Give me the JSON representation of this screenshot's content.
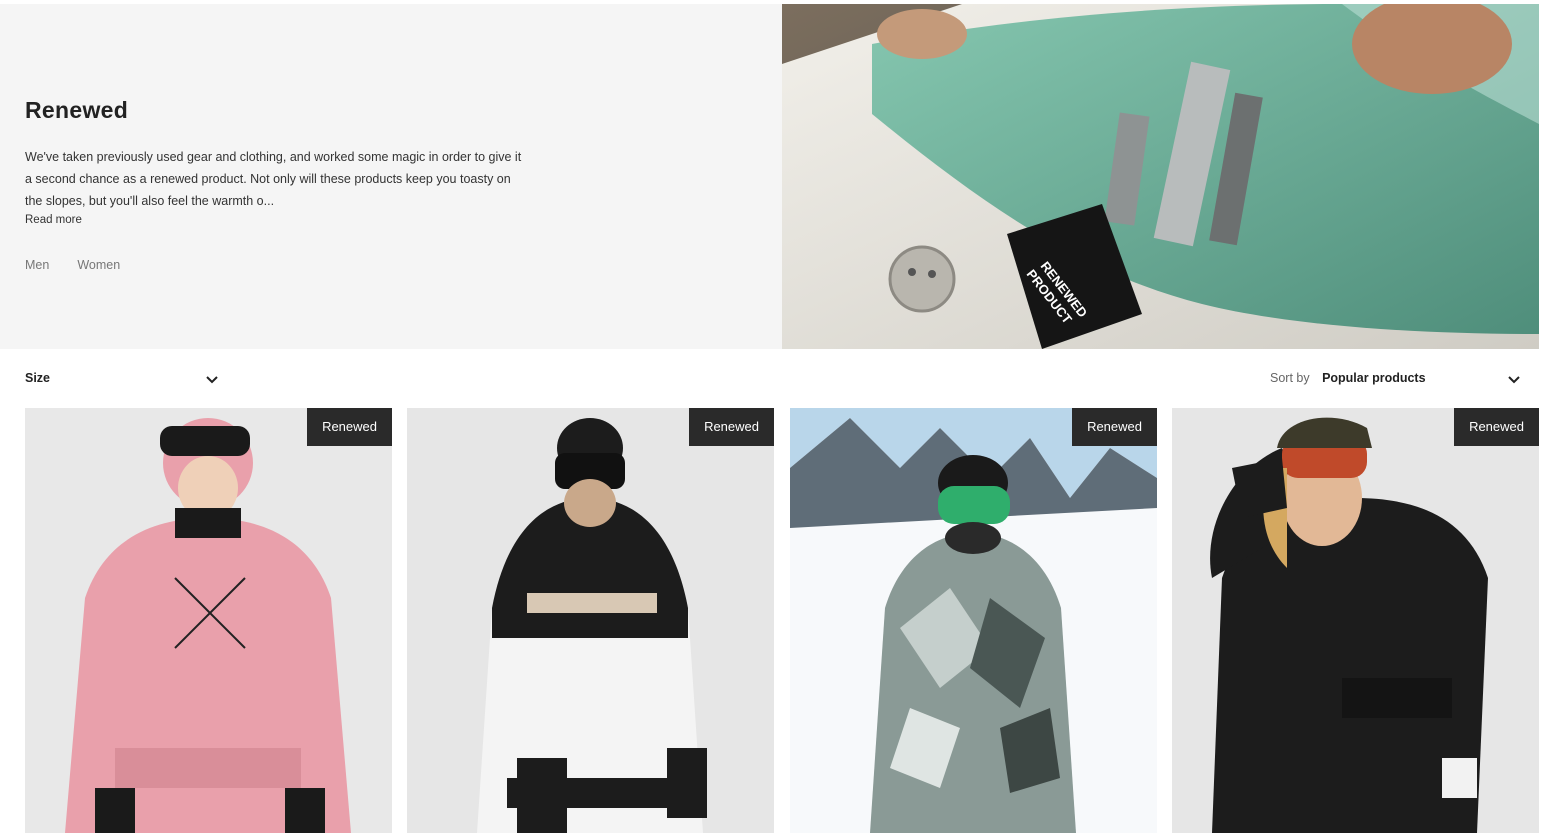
{
  "hero": {
    "title": "Renewed",
    "description": "We've taken previously used gear and clothing, and worked some magic in order to give it a second chance as a renewed product. Not only will these products keep you toasty on the slopes, but you'll also feel the warmth o...",
    "read_more": "Read more",
    "gender_links": [
      "Men",
      "Women"
    ],
    "image_label_line1": "RENEWED",
    "image_label_line2": "PRODUCT"
  },
  "filters": {
    "size_label": "Size",
    "sort_label": "Sort by",
    "sort_value": "Popular products"
  },
  "products": [
    {
      "badge": "Renewed",
      "color": "#e9a0ab"
    },
    {
      "badge": "Renewed",
      "color": "#f4f4f4"
    },
    {
      "badge": "Renewed",
      "color": "#8a9a96"
    },
    {
      "badge": "Renewed",
      "color": "#1c1c1c"
    }
  ],
  "icons": {
    "chevron": "chevron-down-icon"
  }
}
